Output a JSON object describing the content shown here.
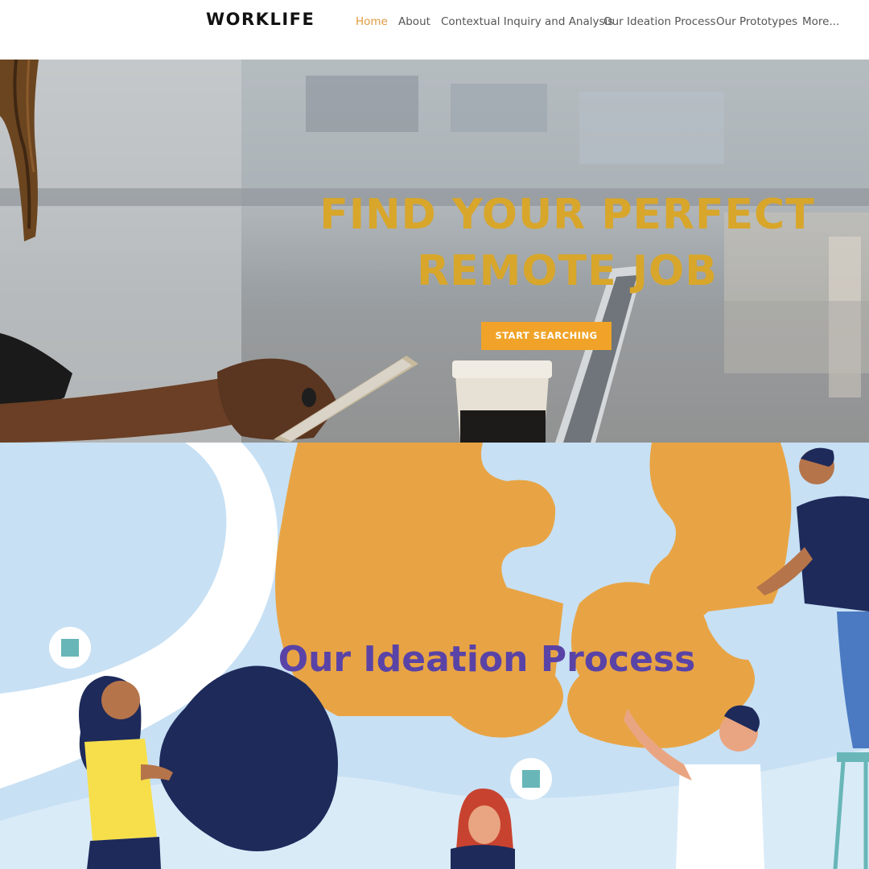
{
  "header": {
    "logo": "WORKLIFE",
    "nav": [
      {
        "label": "Home",
        "active": true
      },
      {
        "label": "About",
        "active": false
      },
      {
        "label": "Contextual Inquiry and Analysis",
        "active": false
      },
      {
        "label": "Our Ideation Process",
        "active": false
      },
      {
        "label": "Our Prototypes",
        "active": false
      },
      {
        "label": "More...",
        "active": false
      }
    ]
  },
  "hero": {
    "title_line1": "FIND YOUR PERFECT",
    "title_line2": "REMOTE JOB",
    "cta_label": "START SEARCHING"
  },
  "ideation": {
    "title": "Our Ideation Process"
  },
  "colors": {
    "accent": "#f0a328",
    "active_nav": "#e09a3e",
    "hero_title": "#d8a62a",
    "ideation_title": "#5a43a6",
    "ideation_bg": "#c7e0f4",
    "puzzle": "#e8a444",
    "navy": "#1e2a5a"
  }
}
